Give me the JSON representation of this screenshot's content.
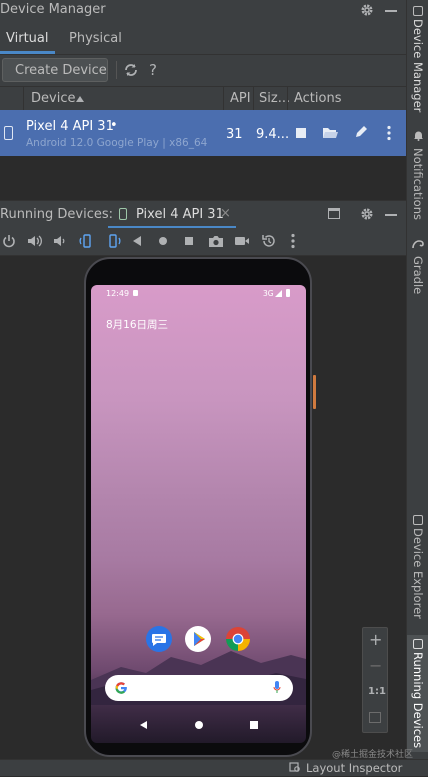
{
  "device_manager": {
    "title": "Device Manager",
    "tabs": [
      "Virtual",
      "Physical"
    ],
    "active_tab": "Virtual",
    "create_button": "Create Device",
    "refresh_icon": "refresh-icon",
    "help_label": "?",
    "columns": {
      "device": "Device",
      "api": "API",
      "size": "Siz...",
      "actions": "Actions"
    },
    "device": {
      "name": "Pixel 4 API 31",
      "dot": "•",
      "subtitle": "Android 12.0 Google Play | x86_64",
      "api": "31",
      "size": "9.4..."
    }
  },
  "running_devices": {
    "label": "Running Devices:",
    "tab": "Pixel 4 API 31",
    "close": "×"
  },
  "phone": {
    "time": "12:49",
    "network": "3G",
    "date": "8月16日周三",
    "zoom": {
      "plus": "+",
      "minus": "−",
      "actual": "1:1"
    }
  },
  "side_tabs": [
    "Device Manager",
    "Notifications",
    "Gradle",
    "Device Explorer",
    "Running Devices"
  ],
  "status": {
    "layout_inspector": "Layout Inspector",
    "watermark": "@稀土掘金技术社区"
  },
  "colors": {
    "selection": "#4b6eaf",
    "panel": "#3c3f41",
    "background": "#2b2b2b",
    "accent": "#5ea5f3"
  }
}
